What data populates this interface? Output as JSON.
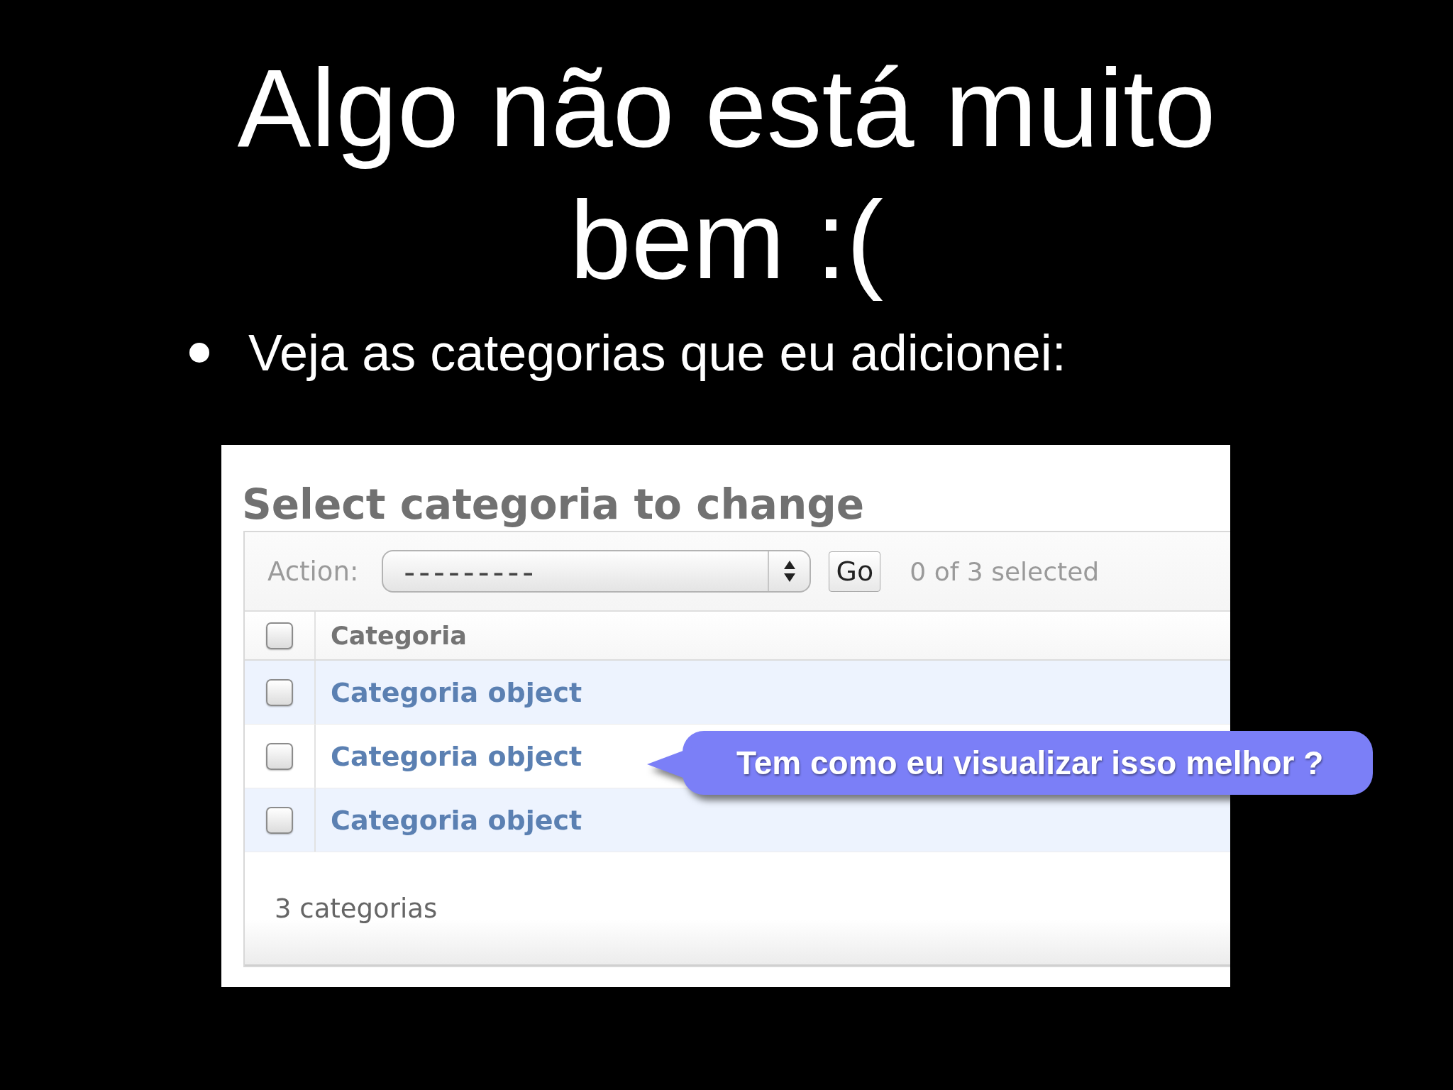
{
  "slide": {
    "title": "Algo não está muito bem :(",
    "bullets": [
      "Veja as categorias que eu adicionei:"
    ],
    "screenshot": {
      "heading": "Select categoria to change",
      "actions": {
        "label": "Action:",
        "select": {
          "value": "---------"
        },
        "go_button": "Go",
        "selection_count": "0 of 3 selected"
      },
      "table": {
        "select_all": {
          "checked": false
        },
        "columns": [
          "Categoria"
        ],
        "rows": [
          {
            "checked": false,
            "cells": [
              "Categoria object"
            ]
          },
          {
            "checked": false,
            "cells": [
              "Categoria object"
            ]
          },
          {
            "checked": false,
            "cells": [
              "Categoria object"
            ]
          }
        ]
      },
      "footer": "3 categorias"
    },
    "callout": {
      "text": "Tem como eu visualizar isso melhor ?"
    }
  }
}
